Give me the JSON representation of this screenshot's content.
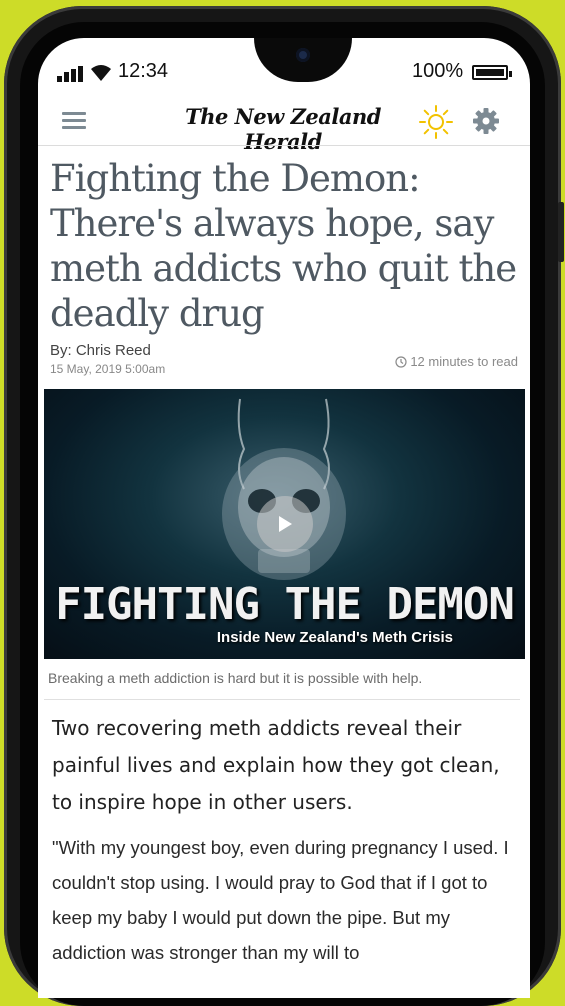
{
  "status_bar": {
    "time": "12:34",
    "battery": "100%"
  },
  "app_bar": {
    "masthead": "The New Zealand Herald"
  },
  "article": {
    "headline": "Fighting the Demon: There's always hope, say meth addicts who quit the deadly drug",
    "byline": "By: Chris Reed",
    "date": "15 May, 2019 5:00am",
    "read_time": "12 minutes to read",
    "video": {
      "title": "FIGHTING THE DEMON",
      "subtitle": "Inside New Zealand's Meth Crisis"
    },
    "caption": "Breaking a meth addiction is hard but it is possible with help.",
    "lede": "Two recovering meth addicts reveal their painful lives and explain how they got clean, to inspire hope in other users.",
    "body": "\"With my youngest boy, even during pregnancy I used. I couldn't stop using. I would pray to God that if I got to keep my baby I would put down the pipe. But my addiction was stronger than my will to"
  },
  "colors": {
    "background": "#cddc28",
    "headline": "#4f5962",
    "sun": "#f2c200",
    "icon_gray": "#7d8a93"
  },
  "icons": [
    "signal-icon",
    "wifi-icon",
    "battery-icon",
    "menu-icon",
    "sun-icon",
    "gear-icon",
    "clock-icon",
    "play-icon"
  ]
}
